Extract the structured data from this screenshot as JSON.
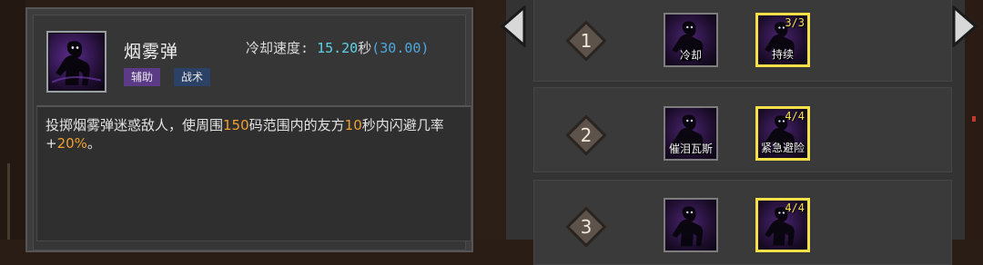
{
  "skill": {
    "name": "烟雾弹",
    "cooldown_label": "冷却速度:",
    "cooldown_value": "15.20",
    "cooldown_unit": "秒",
    "cooldown_base": "(30.00)",
    "tags": [
      "辅助",
      "战术"
    ],
    "description": {
      "p1": "投掷烟雾弹迷惑敌人，使周围",
      "v1": "150",
      "p2": "码范围内的友方",
      "v2": "10",
      "p3": "秒内闪避几率+",
      "v3": "20%",
      "p4": "。"
    }
  },
  "tree": {
    "tiers": [
      {
        "number": "1",
        "nodes": [
          {
            "label": "冷却",
            "count": "",
            "active": false
          },
          {
            "label": "持续",
            "count": "3/3",
            "active": true
          }
        ]
      },
      {
        "number": "2",
        "nodes": [
          {
            "label": "催泪瓦斯",
            "count": "",
            "active": false
          },
          {
            "label": "紧急避险",
            "count": "4/4",
            "active": true
          }
        ]
      },
      {
        "number": "3",
        "nodes": [
          {
            "label": "",
            "count": "",
            "active": false
          },
          {
            "label": "",
            "count": "4/4",
            "active": true
          }
        ]
      }
    ]
  },
  "colors": {
    "accent_cyan": "#5fd2e8",
    "highlight_orange": "#f0a030",
    "active_border": "#f5e04a",
    "tag_support": "#5b3b86",
    "tag_tactic": "#2b4266"
  },
  "icons": [
    "figure-silhouette-icon",
    "diamond-tier-icon",
    "arrow-left-icon",
    "arrow-right-icon"
  ]
}
